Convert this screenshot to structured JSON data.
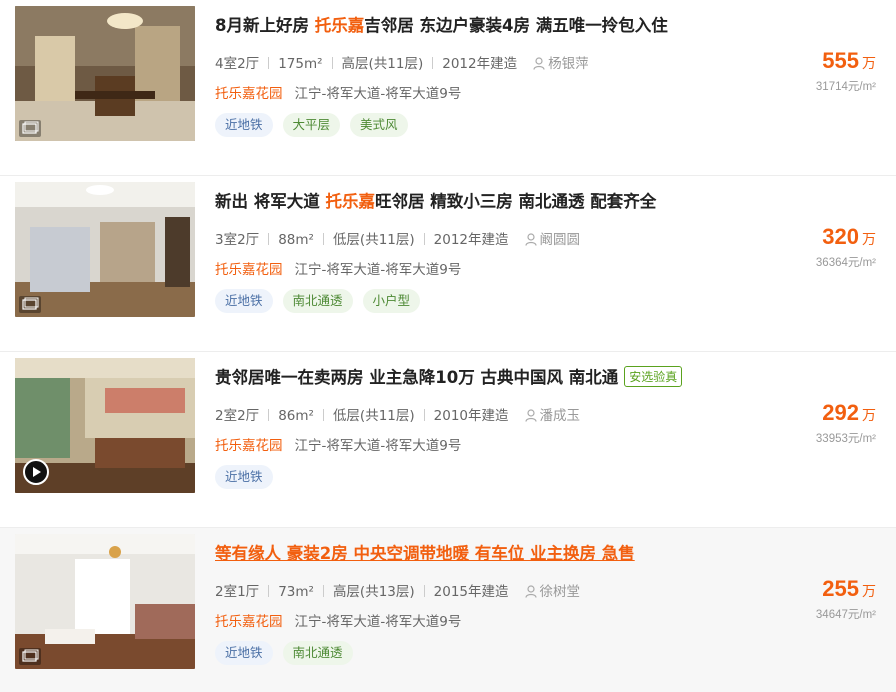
{
  "listings": [
    {
      "title_pre": "8月新上好房 ",
      "title_hl": "托乐嘉",
      "title_post": "吉邻居 东边户豪装4房 满五唯一拎包入住",
      "verified": "",
      "layout": "4室2厅",
      "area": "175m²",
      "floor": "高层(共11层)",
      "year": "2012年建造",
      "agent": "杨银萍",
      "community": "托乐嘉花园",
      "location": "江宁-将军大道-将军大道9号",
      "tags": [
        "近地铁",
        "大平层",
        "美式风"
      ],
      "total_price": "555",
      "price_unit": "万",
      "unit_price": "31714元/m²"
    },
    {
      "title_pre": "新出 将军大道 ",
      "title_hl": "托乐嘉",
      "title_post": "旺邻居 精致小三房 南北通透 配套齐全",
      "verified": "",
      "layout": "3室2厅",
      "area": "88m²",
      "floor": "低层(共11层)",
      "year": "2012年建造",
      "agent": "阚圆圆",
      "community": "托乐嘉花园",
      "location": "江宁-将军大道-将军大道9号",
      "tags": [
        "近地铁",
        "南北通透",
        "小户型"
      ],
      "total_price": "320",
      "price_unit": "万",
      "unit_price": "36364元/m²"
    },
    {
      "title_pre": "贵邻居唯一在卖两房 业主急降10万 古典中国风 南北通",
      "title_hl": "",
      "title_post": "",
      "verified": "安选验真",
      "layout": "2室2厅",
      "area": "86m²",
      "floor": "低层(共11层)",
      "year": "2010年建造",
      "agent": "潘成玉",
      "community": "托乐嘉花园",
      "location": "江宁-将军大道-将军大道9号",
      "tags": [
        "近地铁"
      ],
      "total_price": "292",
      "price_unit": "万",
      "unit_price": "33953元/m²"
    },
    {
      "title_pre": "等有缘人 豪装2房 中央空调带地暖 有车位 业主换房 急售",
      "title_hl": "",
      "title_post": "",
      "verified": "",
      "layout": "2室1厅",
      "area": "73m²",
      "floor": "高层(共13层)",
      "year": "2015年建造",
      "agent": "徐树堂",
      "community": "托乐嘉花园",
      "location": "江宁-将军大道-将军大道9号",
      "tags": [
        "近地铁",
        "南北通透"
      ],
      "total_price": "255",
      "price_unit": "万",
      "unit_price": "34647元/m²"
    }
  ],
  "colors": {
    "accent": "#f25f0f",
    "verified": "#5aa21e"
  },
  "icons": [
    "photo-icon",
    "video-play-icon",
    "user-icon"
  ]
}
